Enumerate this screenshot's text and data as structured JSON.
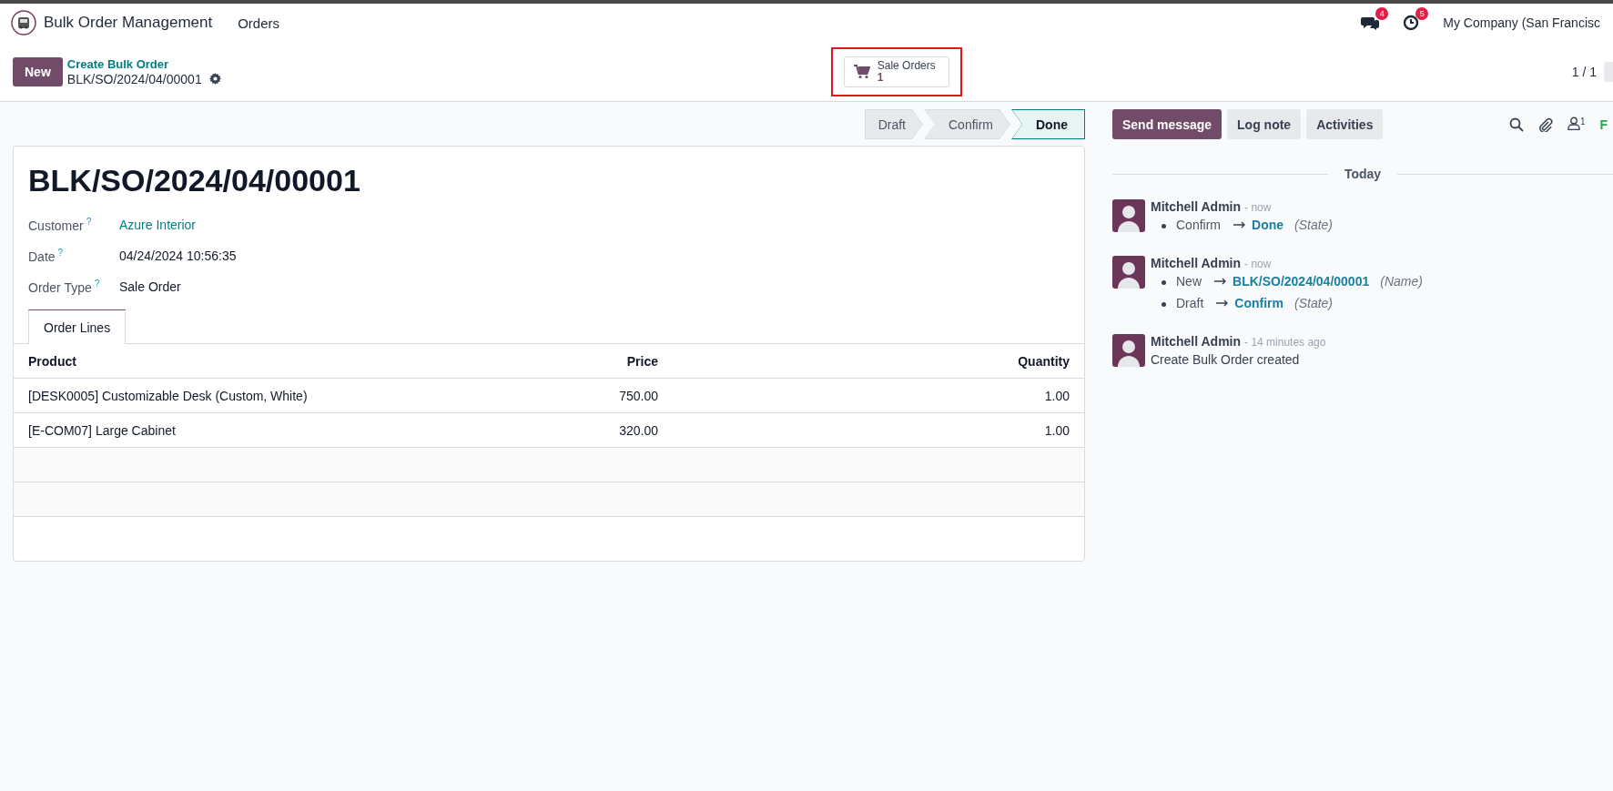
{
  "navbar": {
    "app_name": "Bulk Order Management",
    "menu": [
      "Orders"
    ],
    "messages_badge": "4",
    "activities_badge": "5",
    "company": "My Company (San Francisc"
  },
  "control_panel": {
    "new_button": "New",
    "breadcrumb_parent": "Create Bulk Order",
    "breadcrumb_current": "BLK/SO/2024/04/00001",
    "smart_button": {
      "label": "Sale Orders",
      "count": "1"
    },
    "pager": "1 / 1"
  },
  "status_steps": [
    {
      "label": "Draft",
      "selected": false
    },
    {
      "label": "Confirm",
      "selected": false
    },
    {
      "label": "Done",
      "selected": true
    }
  ],
  "form": {
    "title": "BLK/SO/2024/04/00001",
    "fields": [
      {
        "label": "Customer",
        "help": "?",
        "value": "Azure Interior",
        "kind": "link"
      },
      {
        "label": "Date",
        "help": "?",
        "value": "04/24/2024 10:56:35",
        "kind": "text"
      },
      {
        "label": "Order Type",
        "help": "?",
        "value": "Sale Order",
        "kind": "text"
      }
    ],
    "tabs": [
      {
        "label": "Order Lines",
        "selected": true
      }
    ],
    "table": {
      "columns": [
        "Product",
        "Price",
        "Quantity"
      ],
      "rows": [
        {
          "product": "[DESK0005] Customizable Desk (Custom, White)",
          "price": "750.00",
          "quantity": "1.00"
        },
        {
          "product": "[E-COM07] Large Cabinet",
          "price": "320.00",
          "quantity": "1.00"
        }
      ]
    }
  },
  "chatter": {
    "buttons": [
      {
        "label": "Send message",
        "selected": true
      },
      {
        "label": "Log note",
        "selected": false
      },
      {
        "label": "Activities",
        "selected": false
      }
    ],
    "followers_count": "1",
    "follow_label": "F",
    "date_separator": "Today",
    "messages": [
      {
        "author": "Mitchell Admin",
        "time": "- now",
        "kind": "tracking",
        "changes": [
          {
            "old": "Confirm",
            "new": "Done",
            "field": "(State)"
          }
        ]
      },
      {
        "author": "Mitchell Admin",
        "time": "- now",
        "kind": "tracking",
        "changes": [
          {
            "old": "New",
            "new": "BLK/SO/2024/04/00001",
            "field": "(Name)"
          },
          {
            "old": "Draft",
            "new": "Confirm",
            "field": "(State)"
          }
        ]
      },
      {
        "author": "Mitchell Admin",
        "time": "- 14 minutes ago",
        "kind": "text",
        "body": "Create Bulk Order created"
      }
    ]
  }
}
